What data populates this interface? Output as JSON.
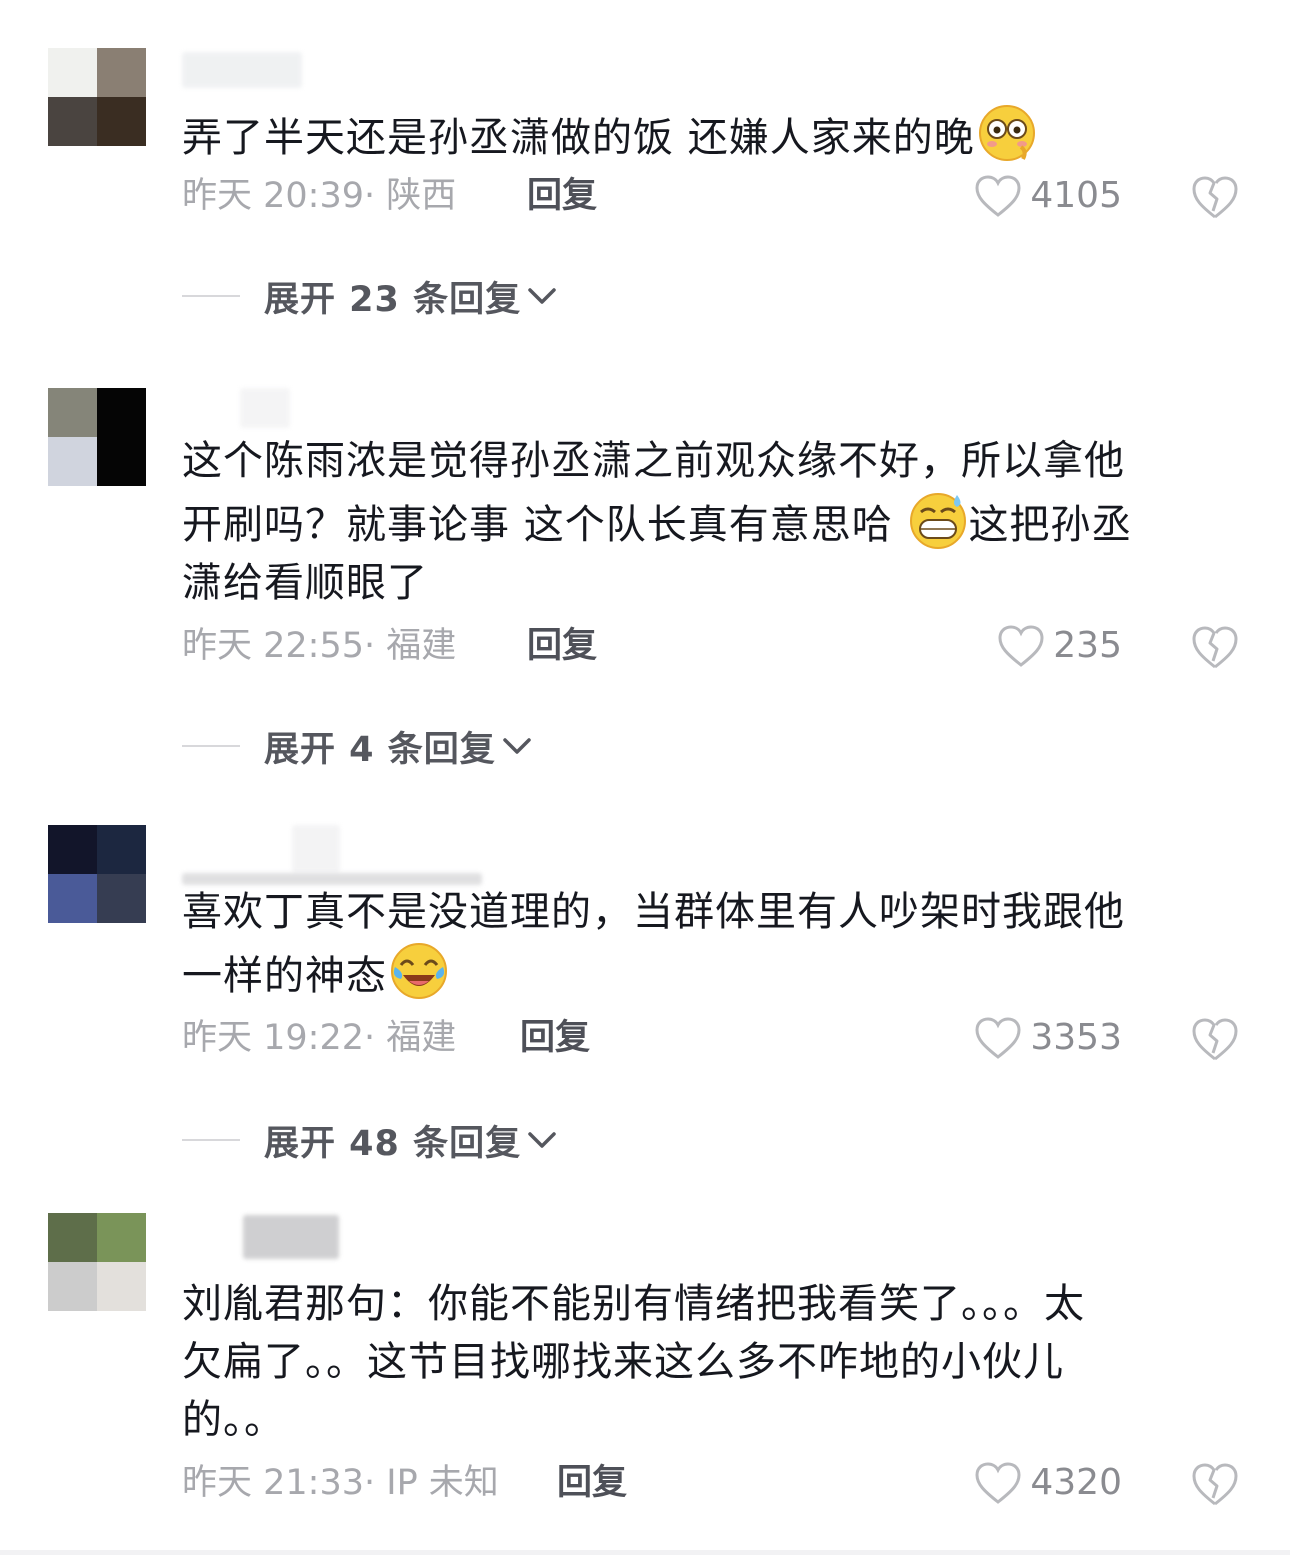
{
  "comments": [
    {
      "text": "弄了半天还是孙丞潇做的饭 还嫌人家来的晚",
      "emoji": "flushed-face-emoji",
      "time": "昨天 20:39",
      "location": "· 陕西",
      "reply_label": "回复",
      "likes": "4105",
      "expand_label": "展开 23 条回复",
      "avatar_colors": [
        "#f0f1ee",
        "#8a7f73",
        "#4a4440",
        "#3a2d22"
      ]
    },
    {
      "text_line1": "这个陈雨浓是觉得孙丞潇之前观众缘不好，所以拿他",
      "text_line2a": "开刷吗？就事论事 这个队长真有意思哈",
      "text_line2b": "这把孙丞",
      "text_line3": "潇给看顺眼了",
      "emoji": "grinning-sweat-emoji",
      "time": "昨天 22:55",
      "location": "· 福建",
      "reply_label": "回复",
      "likes": "235",
      "expand_label": "展开 4 条回复",
      "avatar_colors": [
        "#858579",
        "#050505",
        "#d0d4de",
        "#050505"
      ]
    },
    {
      "text_line1": "喜欢丁真不是没道理的，当群体里有人吵架时我跟他",
      "text_line2": "一样的神态",
      "emoji": "tears-of-joy-emoji",
      "time": "昨天 19:22",
      "location": "· 福建",
      "reply_label": "回复",
      "likes": "3353",
      "expand_label": "展开 48 条回复",
      "avatar_colors": [
        "#12152a",
        "#1c2740",
        "#4a5a98",
        "#363d52"
      ]
    },
    {
      "text_line1": "刘胤君那句：你能不能别有情绪把我看笑了。。。太",
      "text_line2": "欠扁了。。这节目找哪找来这么多不咋地的小伙儿",
      "text_line3": "的。。",
      "time": "昨天 21:33",
      "location": "· IP 未知",
      "reply_label": "回复",
      "likes": "4320",
      "avatar_colors": [
        "#5e6e4a",
        "#7a9459",
        "#cccccc",
        "#e3e0dc"
      ]
    }
  ],
  "colors": {
    "text": "#16181f",
    "meta": "#a7a8ad",
    "reply": "#4e5058",
    "like_icon": "#b8b9bd"
  }
}
